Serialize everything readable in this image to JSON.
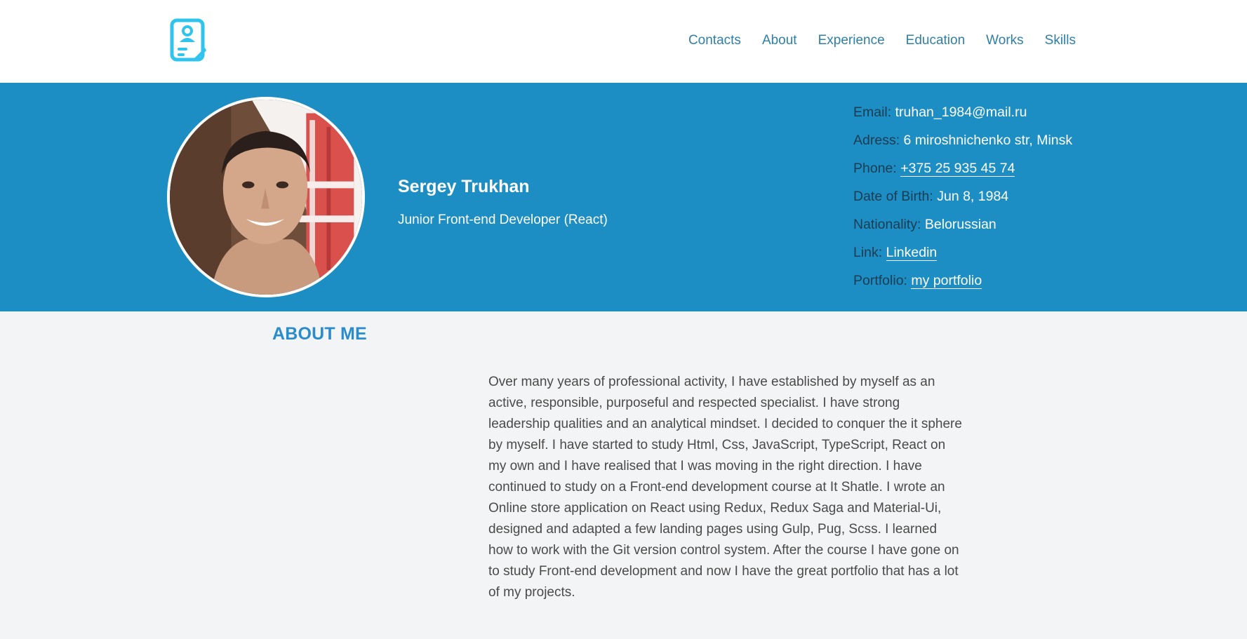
{
  "nav": {
    "items": [
      {
        "label": "Contacts"
      },
      {
        "label": "About"
      },
      {
        "label": "Experience"
      },
      {
        "label": "Education"
      },
      {
        "label": "Works"
      },
      {
        "label": "Skills"
      }
    ]
  },
  "profile": {
    "name": "Sergey Trukhan",
    "role": "Junior Front-end Developer (React)"
  },
  "contacts": {
    "email_label": "Email:",
    "email_value": "truhan_1984@mail.ru",
    "address_label": "Adress:",
    "address_value": "6 miroshnichenko str, Minsk",
    "phone_label": "Phone:",
    "phone_value": "+375 25 935 45 74",
    "dob_label": "Date of Birth:",
    "dob_value": "Jun 8, 1984",
    "nationality_label": "Nationality:",
    "nationality_value": "Belorussian",
    "link_label": "Link:",
    "link_value": "Linkedin",
    "portfolio_label": "Portfolio:",
    "portfolio_value": "my portfolio"
  },
  "about": {
    "title": "ABOUT ME",
    "text": "Over many years of professional activity, I have established by myself as an active, responsible, purposeful and respected specialist. I have strong leadership qualities and an analytical mindset. I decided to conquer the it sphere by myself. I have started to study Html, Css, JavaScript, TypeScript, React on my own and I have realised that I was moving in the right direction. I have continued to study on a Front-end development course at It Shatle. I wrote an Online store application on React using Redux, Redux Saga and Material-Ui, designed and adapted a few landing pages using Gulp, Pug, Scss. I learned how to work with the Git version control system. After the course I have gone on to study Front-end development and now I have the great portfolio that has a lot of my projects."
  },
  "colors": {
    "hero_bg": "#1c8ec3",
    "accent": "#2b8ccc",
    "nav_link": "#2f7fa6",
    "page_bg": "#f3f4f6"
  },
  "icons": {
    "logo": "resume-document-icon"
  }
}
